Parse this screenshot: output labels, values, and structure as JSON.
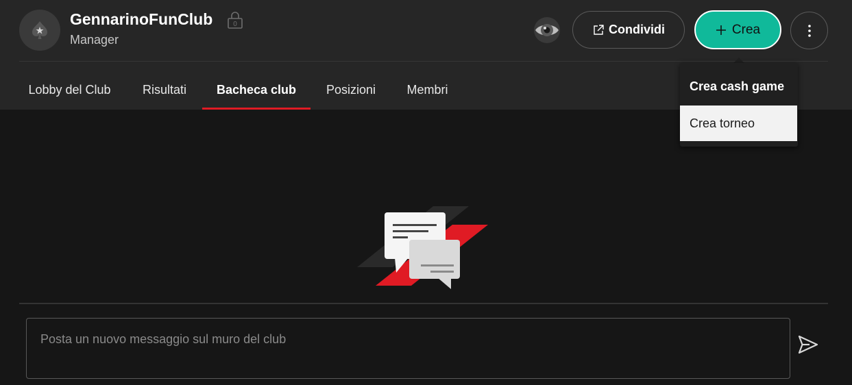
{
  "header": {
    "club_name": "GennarinoFunClub",
    "role": "Manager",
    "share_label": "Condividi",
    "create_label": "Crea",
    "lock_count": "0"
  },
  "tabs": [
    {
      "label": "Lobby del Club",
      "active": false
    },
    {
      "label": "Risultati",
      "active": false
    },
    {
      "label": "Bacheca club",
      "active": true
    },
    {
      "label": "Posizioni",
      "active": false
    },
    {
      "label": "Membri",
      "active": false
    }
  ],
  "create_menu": {
    "items": [
      {
        "label": "Crea cash game"
      },
      {
        "label": "Crea torneo"
      }
    ]
  },
  "composer": {
    "placeholder": "Posta un nuovo messaggio sul muro del club",
    "value": ""
  },
  "colors": {
    "accent_green": "#10b99a",
    "active_tab_underline": "#e01b24",
    "background": "#161616",
    "header_background": "#262626"
  },
  "icons": {
    "club_avatar": "spade-star-icon",
    "lock": "lock-icon",
    "privacy": "eye-icon",
    "share": "external-link-icon",
    "create": "plus-icon",
    "more": "more-vertical-icon",
    "send": "send-icon",
    "empty_state": "chat-bubbles-illustration"
  }
}
